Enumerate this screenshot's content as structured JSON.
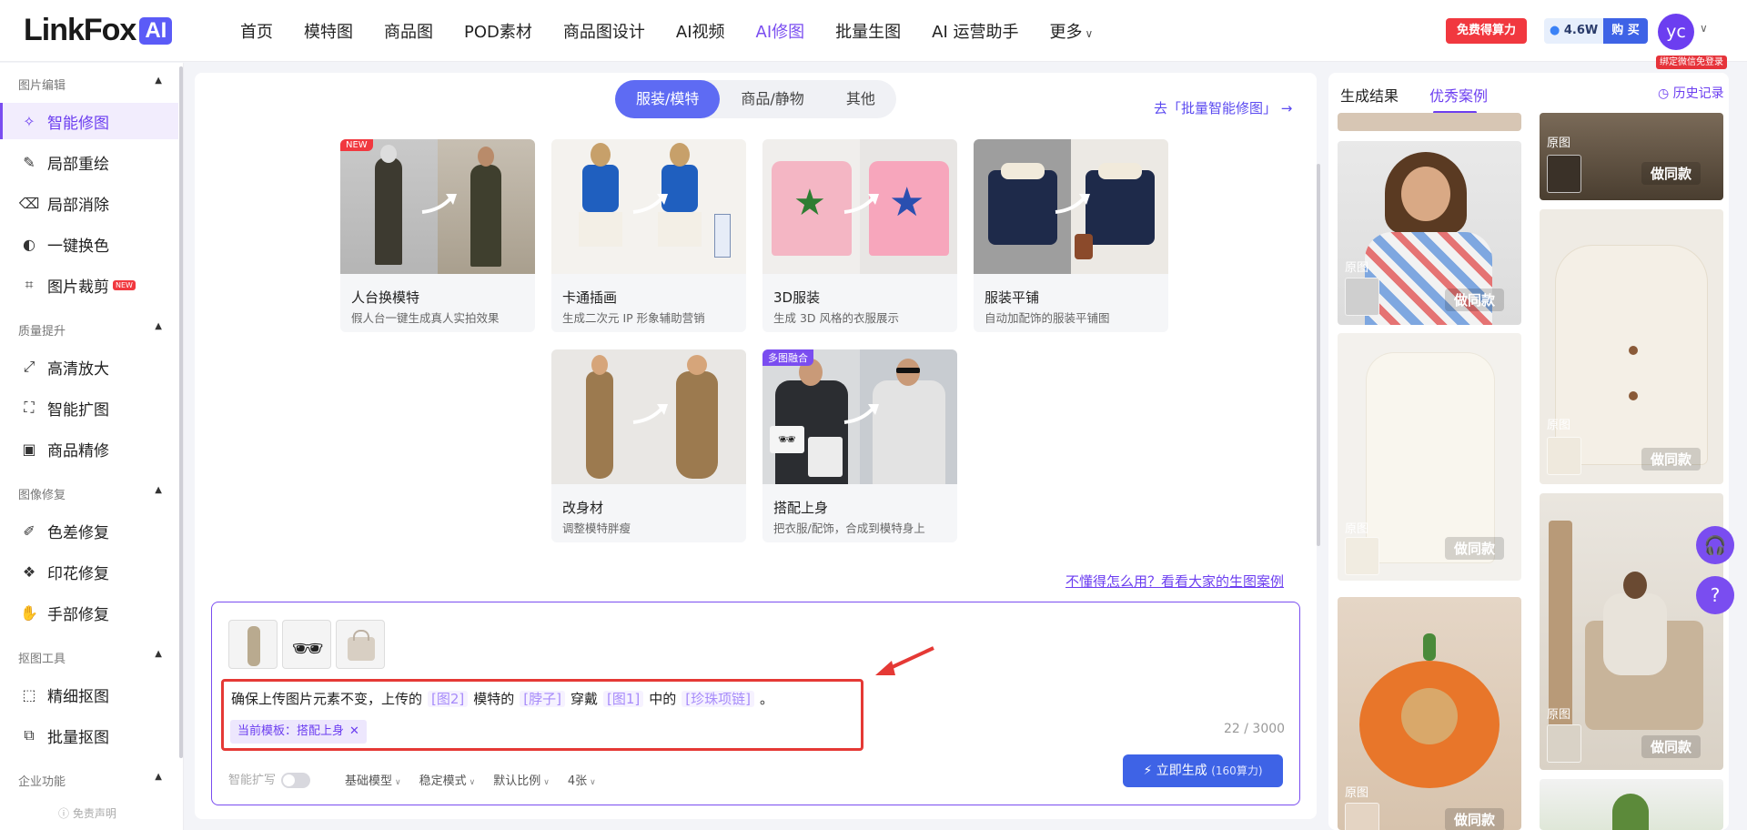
{
  "brand": {
    "name": "LinkFox",
    "badge": "AI"
  },
  "nav": {
    "items": [
      "首页",
      "模特图",
      "商品图",
      "POD素材",
      "商品图设计",
      "AI视频",
      "AI修图",
      "批量生图",
      "AI 运营助手",
      "更多"
    ],
    "active": "AI修图"
  },
  "header": {
    "promo": "免费得算力",
    "points_value": "4.6W",
    "buy": "购 买",
    "avatar": "yc",
    "bind_wechat": "绑定微信免登录"
  },
  "sidebar": {
    "sections": [
      {
        "title": "图片编辑",
        "items": [
          "智能修图",
          "局部重绘",
          "局部消除",
          "一键换色",
          "图片裁剪"
        ]
      },
      {
        "title": "质量提升",
        "items": [
          "高清放大",
          "智能扩图",
          "商品精修"
        ]
      },
      {
        "title": "图像修复",
        "items": [
          "色差修复",
          "印花修复",
          "手部修复"
        ]
      },
      {
        "title": "抠图工具",
        "items": [
          "精细抠图",
          "批量抠图"
        ]
      },
      {
        "title": "企业功能",
        "items": []
      }
    ],
    "active_item": "智能修图",
    "new_badge": "NEW",
    "disclaimer": "免责声明"
  },
  "main": {
    "segments": [
      "服装/模特",
      "商品/静物",
      "其他"
    ],
    "active_segment": "服装/模特",
    "batch_link": "去「批量智能修图」",
    "cards": [
      {
        "title": "人台换模特",
        "desc": "假人台一键生成真人实拍效果",
        "tag": "NEW"
      },
      {
        "title": "卡通插画",
        "desc": "生成二次元 IP 形象辅助营销",
        "tag": ""
      },
      {
        "title": "3D服装",
        "desc": "生成 3D 风格的衣服展示",
        "tag": ""
      },
      {
        "title": "服装平铺",
        "desc": "自动加配饰的服装平铺图",
        "tag": ""
      },
      {
        "title": "改身材",
        "desc": "调整模特胖瘦",
        "tag": ""
      },
      {
        "title": "搭配上身",
        "desc": "把衣服/配饰，合成到模特身上",
        "tag": "多图融合"
      }
    ],
    "help_link": "不懂得怎么用？看看大家的生图案例"
  },
  "editor": {
    "prompt_parts": [
      "确保上传图片元素不变，上传的",
      "[图2]",
      "模特的",
      "[脖子]",
      "穿戴",
      "[图1]",
      "中的",
      "[珍珠项链]",
      "。"
    ],
    "template_chip": "当前模板：搭配上身",
    "char_count": "22 / 3000",
    "options": {
      "smart_expand": "智能扩写",
      "model": "基础模型",
      "mode": "稳定模式",
      "ratio": "默认比例",
      "count": "4张"
    },
    "generate_label": "立即生成",
    "generate_cost": "(160算力)"
  },
  "right": {
    "tabs": [
      "生成结果",
      "优秀案例"
    ],
    "active_tab": "优秀案例",
    "history": "历史记录",
    "original_label": "原图",
    "same_label": "做同款"
  },
  "colors": {
    "accent": "#7a4df0",
    "primary_blue": "#3e63e6",
    "promo_red": "#f1383f"
  }
}
